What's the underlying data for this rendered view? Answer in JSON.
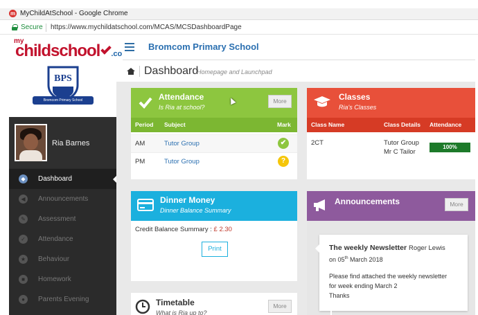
{
  "browser": {
    "title": "MyChildAtSchool - Google Chrome",
    "secure_label": "Secure",
    "url": "https://www.mychildatschool.com/MCAS/MCSDashboardPage"
  },
  "logo": {
    "my": "my",
    "main": "childschool",
    "com": ".com"
  },
  "header": {
    "school": "Bromcom Primary School"
  },
  "crest": {
    "letters": "BPS",
    "ribbon": "Bromcom Primary School"
  },
  "user": {
    "name": "Ria Barnes"
  },
  "nav": {
    "items": [
      {
        "label": "Dashboard",
        "icon": "dashboard-icon"
      },
      {
        "label": "Announcements",
        "icon": "megaphone-icon"
      },
      {
        "label": "Assessment",
        "icon": "pencil-icon"
      },
      {
        "label": "Attendance",
        "icon": "check-icon"
      },
      {
        "label": "Behaviour",
        "icon": "star-icon"
      },
      {
        "label": "Homework",
        "icon": "briefcase-icon"
      },
      {
        "label": "Parents Evening",
        "icon": "people-icon"
      }
    ]
  },
  "page": {
    "title": "Dashboard",
    "subtitle": "Homepage and Launchpad"
  },
  "attendance": {
    "title": "Attendance",
    "subtitle": "Is Ria at school?",
    "more": "More",
    "columns": [
      "Period",
      "Subject",
      "Mark"
    ],
    "rows": [
      {
        "period": "AM",
        "subject": "Tutor Group",
        "mark": "✔",
        "status": "present"
      },
      {
        "period": "PM",
        "subject": "Tutor Group",
        "mark": "?",
        "status": "unknown"
      }
    ],
    "colors": {
      "header": "#8dc63f",
      "present": "#8dc63f",
      "unknown": "#f5c60a"
    }
  },
  "classes": {
    "title": "Classes",
    "subtitle": "Ria's Classes",
    "columns": [
      "Class Name",
      "Class Details",
      "Attendance"
    ],
    "rows": [
      {
        "name": "2CT",
        "details_1": "Tutor Group",
        "details_2": "Mr C Tailor",
        "attendance": "100%",
        "attendance_value": 1.0
      }
    ],
    "colors": {
      "header": "#e8503a"
    }
  },
  "dinner": {
    "title": "Dinner Money",
    "subtitle": "Dinner Balance Summary",
    "balance_label": "Credit Balance Summary : ",
    "balance_value": "£ 2.30",
    "print": "Print",
    "colors": {
      "header": "#1bb0de"
    }
  },
  "announcements": {
    "title": "Announcements",
    "more": "More",
    "item": {
      "heading": "The weekly Newsletter",
      "author": "Roger Lewis",
      "date_pre": "on 05",
      "date_sup": "th",
      "date_post": " March 2018",
      "body_1": "Please find attached the weekly newsletter",
      "body_2": "for week ending March 2",
      "body_3": "Thanks"
    },
    "colors": {
      "header": "#8e5a9d"
    }
  },
  "timetable": {
    "title": "Timetable",
    "subtitle": "What is Ria up to?",
    "more": "More"
  }
}
